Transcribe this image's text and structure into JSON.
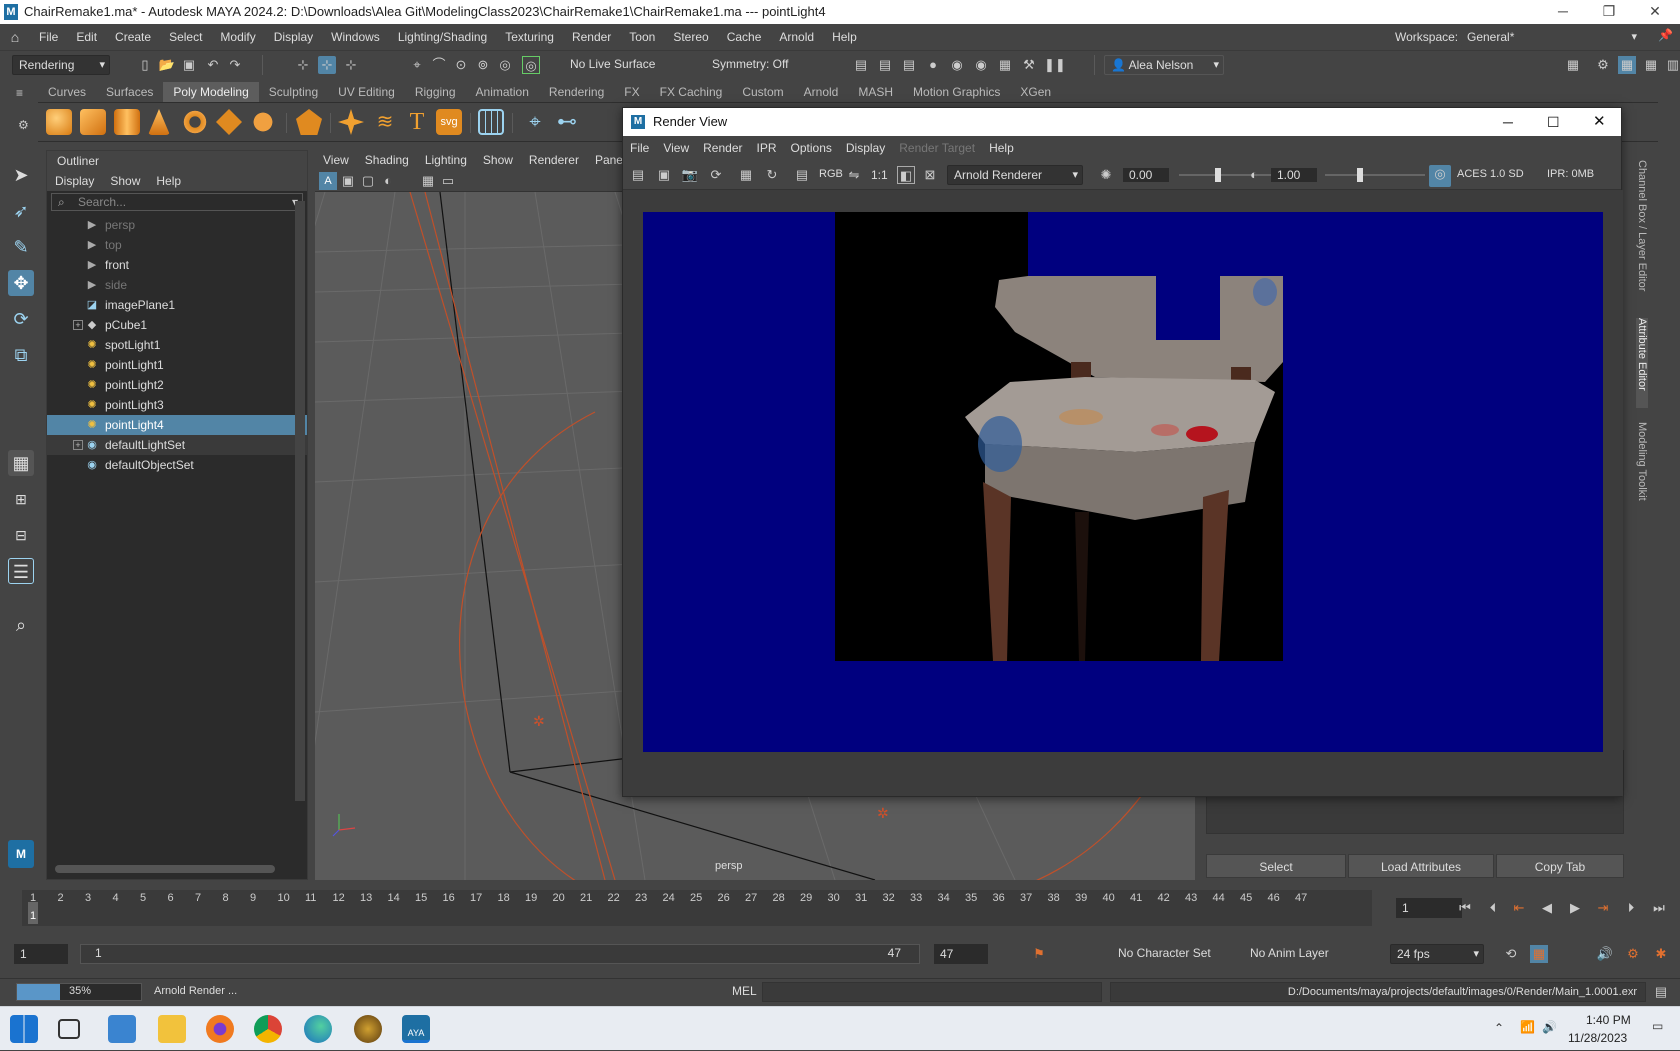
{
  "window": {
    "title": "ChairRemake1.ma* - Autodesk MAYA 2024.2: D:\\Downloads\\Alea Git\\ModelingClass2023\\ChairRemake1\\ChairRemake1.ma  ---  pointLight4"
  },
  "menubar": {
    "items": [
      "File",
      "Edit",
      "Create",
      "Select",
      "Modify",
      "Display",
      "Windows",
      "Lighting/Shading",
      "Texturing",
      "Render",
      "Toon",
      "Stereo",
      "Cache",
      "Arnold",
      "Help"
    ],
    "workspace_label": "Workspace:",
    "workspace_value": "General*"
  },
  "statusline": {
    "menuset": "Rendering",
    "live_surface": "No Live Surface",
    "symmetry": "Symmetry: Off",
    "user": "Alea Nelson"
  },
  "shelf": {
    "tabs": [
      "Curves",
      "Surfaces",
      "Poly Modeling",
      "Sculpting",
      "UV Editing",
      "Rigging",
      "Animation",
      "Rendering",
      "FX",
      "FX Caching",
      "Custom",
      "Arnold",
      "MASH",
      "Motion Graphics",
      "XGen"
    ],
    "active_tab": "Poly Modeling",
    "text_icons": {
      "type": "T",
      "svg": "svg"
    }
  },
  "outliner": {
    "title": "Outliner",
    "menu": [
      "Display",
      "Show",
      "Help"
    ],
    "search_placeholder": "Search...",
    "items": [
      {
        "label": "persp",
        "icon": "camera-icon",
        "state": "dim"
      },
      {
        "label": "top",
        "icon": "camera-icon",
        "state": "dim"
      },
      {
        "label": "front",
        "icon": "camera-icon",
        "state": "normal"
      },
      {
        "label": "side",
        "icon": "camera-icon",
        "state": "dim"
      },
      {
        "label": "imagePlane1",
        "icon": "image-plane-icon",
        "state": "normal"
      },
      {
        "label": "pCube1",
        "icon": "mesh-icon",
        "state": "normal",
        "expand": true
      },
      {
        "label": "spotLight1",
        "icon": "light-icon",
        "state": "normal"
      },
      {
        "label": "pointLight1",
        "icon": "light-icon",
        "state": "normal"
      },
      {
        "label": "pointLight2",
        "icon": "light-icon",
        "state": "normal"
      },
      {
        "label": "pointLight3",
        "icon": "light-icon",
        "state": "normal"
      },
      {
        "label": "pointLight4",
        "icon": "light-icon",
        "state": "selected"
      },
      {
        "label": "defaultLightSet",
        "icon": "set-icon",
        "state": "set",
        "expand": true
      },
      {
        "label": "defaultObjectSet",
        "icon": "set-icon",
        "state": "normal"
      }
    ]
  },
  "viewport": {
    "menu": [
      "View",
      "Shading",
      "Lighting",
      "Show",
      "Renderer",
      "Panels"
    ],
    "camera_label": "persp"
  },
  "render_view": {
    "title": "Render View",
    "menu": [
      "File",
      "View",
      "Render",
      "IPR",
      "Options",
      "Display",
      "Render Target",
      "Help"
    ],
    "disabled_menu": "Render Target",
    "renderer": "Arnold Renderer",
    "ratio_label": "1:1",
    "rgb_label": "RGB",
    "exposure": "0.00",
    "gamma": "1.00",
    "color_space": "ACES 1.0 SD",
    "ipr_memory": "IPR: 0MB"
  },
  "right_panel": {
    "tabs": [
      "Channel Box / Layer Editor",
      "Attribute Editor",
      "Modeling Toolkit"
    ],
    "buttons": [
      "Select",
      "Load Attributes",
      "Copy Tab"
    ]
  },
  "timeline": {
    "ticks": [
      "1",
      "2",
      "3",
      "4",
      "5",
      "6",
      "7",
      "8",
      "9",
      "10",
      "11",
      "12",
      "13",
      "14",
      "15",
      "16",
      "17",
      "18",
      "19",
      "20",
      "21",
      "22",
      "23",
      "24",
      "25",
      "26",
      "27",
      "28",
      "29",
      "30",
      "31",
      "32",
      "33",
      "34",
      "35",
      "36",
      "37",
      "38",
      "39",
      "40",
      "41",
      "42",
      "43",
      "44",
      "45",
      "46",
      "47"
    ],
    "current_frame": "1",
    "current_frame_field": "1"
  },
  "range": {
    "start": "1",
    "range_start": "1",
    "range_end": "47",
    "end": "47",
    "character_set": "No Character Set",
    "anim_layer": "No Anim Layer",
    "fps": "24 fps"
  },
  "command": {
    "progress_label": "35%",
    "progress_value": 0.35,
    "progress_text": "Arnold Render ...",
    "mel_label": "MEL",
    "output_path": "D:/Documents/maya/projects/default/images/0/Render/Main_1.0001.exr"
  },
  "taskbar": {
    "time": "1:40 PM",
    "date": "11/28/2023",
    "maya_label": "AYA"
  },
  "colors": {
    "render_bg_blue": "#00007f",
    "selection": "#5285a6",
    "accent_cyan": "#9cd3f0"
  }
}
